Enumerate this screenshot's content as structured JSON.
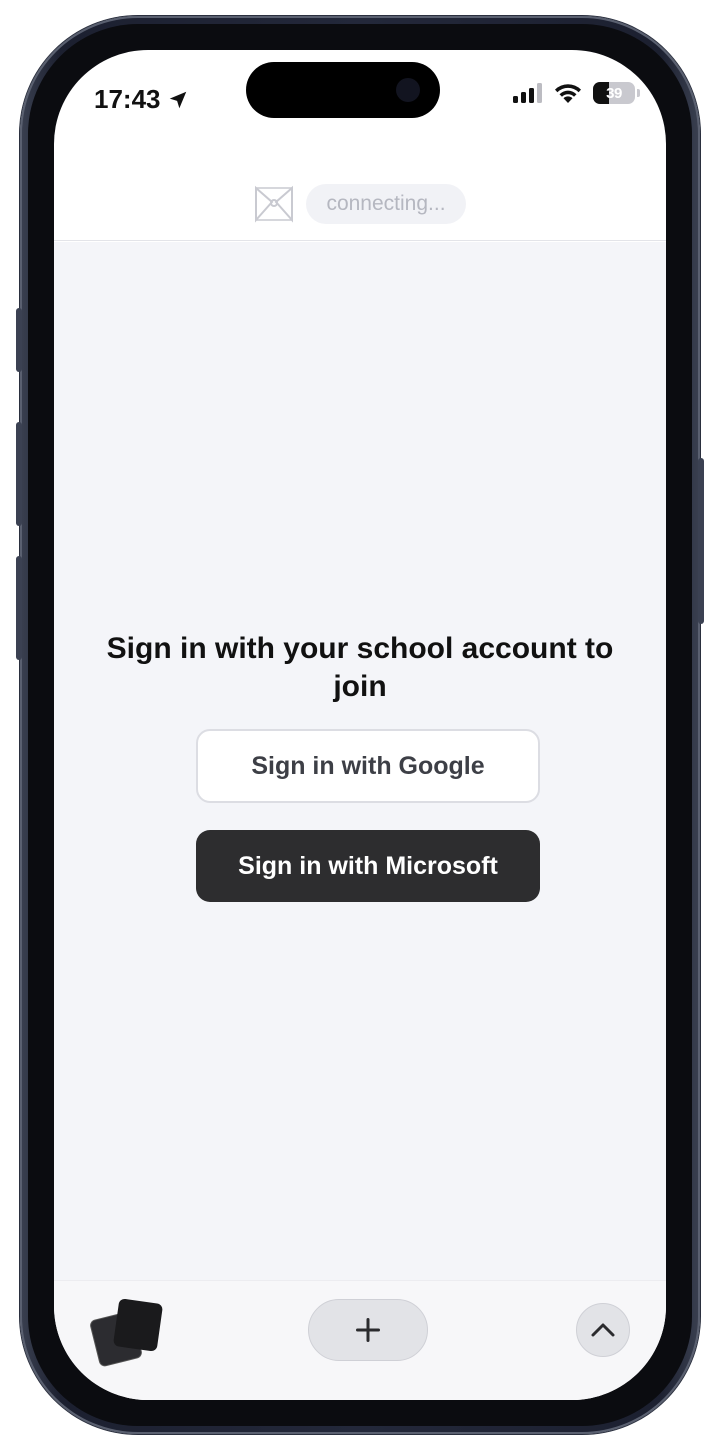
{
  "status_bar": {
    "time": "17:43",
    "battery": "39",
    "icons": [
      "location-arrow-icon",
      "cellular-signal-icon",
      "wifi-icon",
      "battery-icon"
    ]
  },
  "header": {
    "logo_icon": "bowtie-logo-icon",
    "status_text": "connecting..."
  },
  "signin": {
    "title": "Sign in with your school account to join",
    "google_label": "Sign in with Google",
    "microsoft_label": "Sign in with Microsoft"
  },
  "bottom_bar": {
    "icons": [
      "tabs-icon",
      "plus-icon",
      "chevron-up-icon"
    ]
  },
  "colors": {
    "background": "#f4f5f9",
    "primary_button": "#2d2d2f",
    "frame": "#23283a"
  }
}
